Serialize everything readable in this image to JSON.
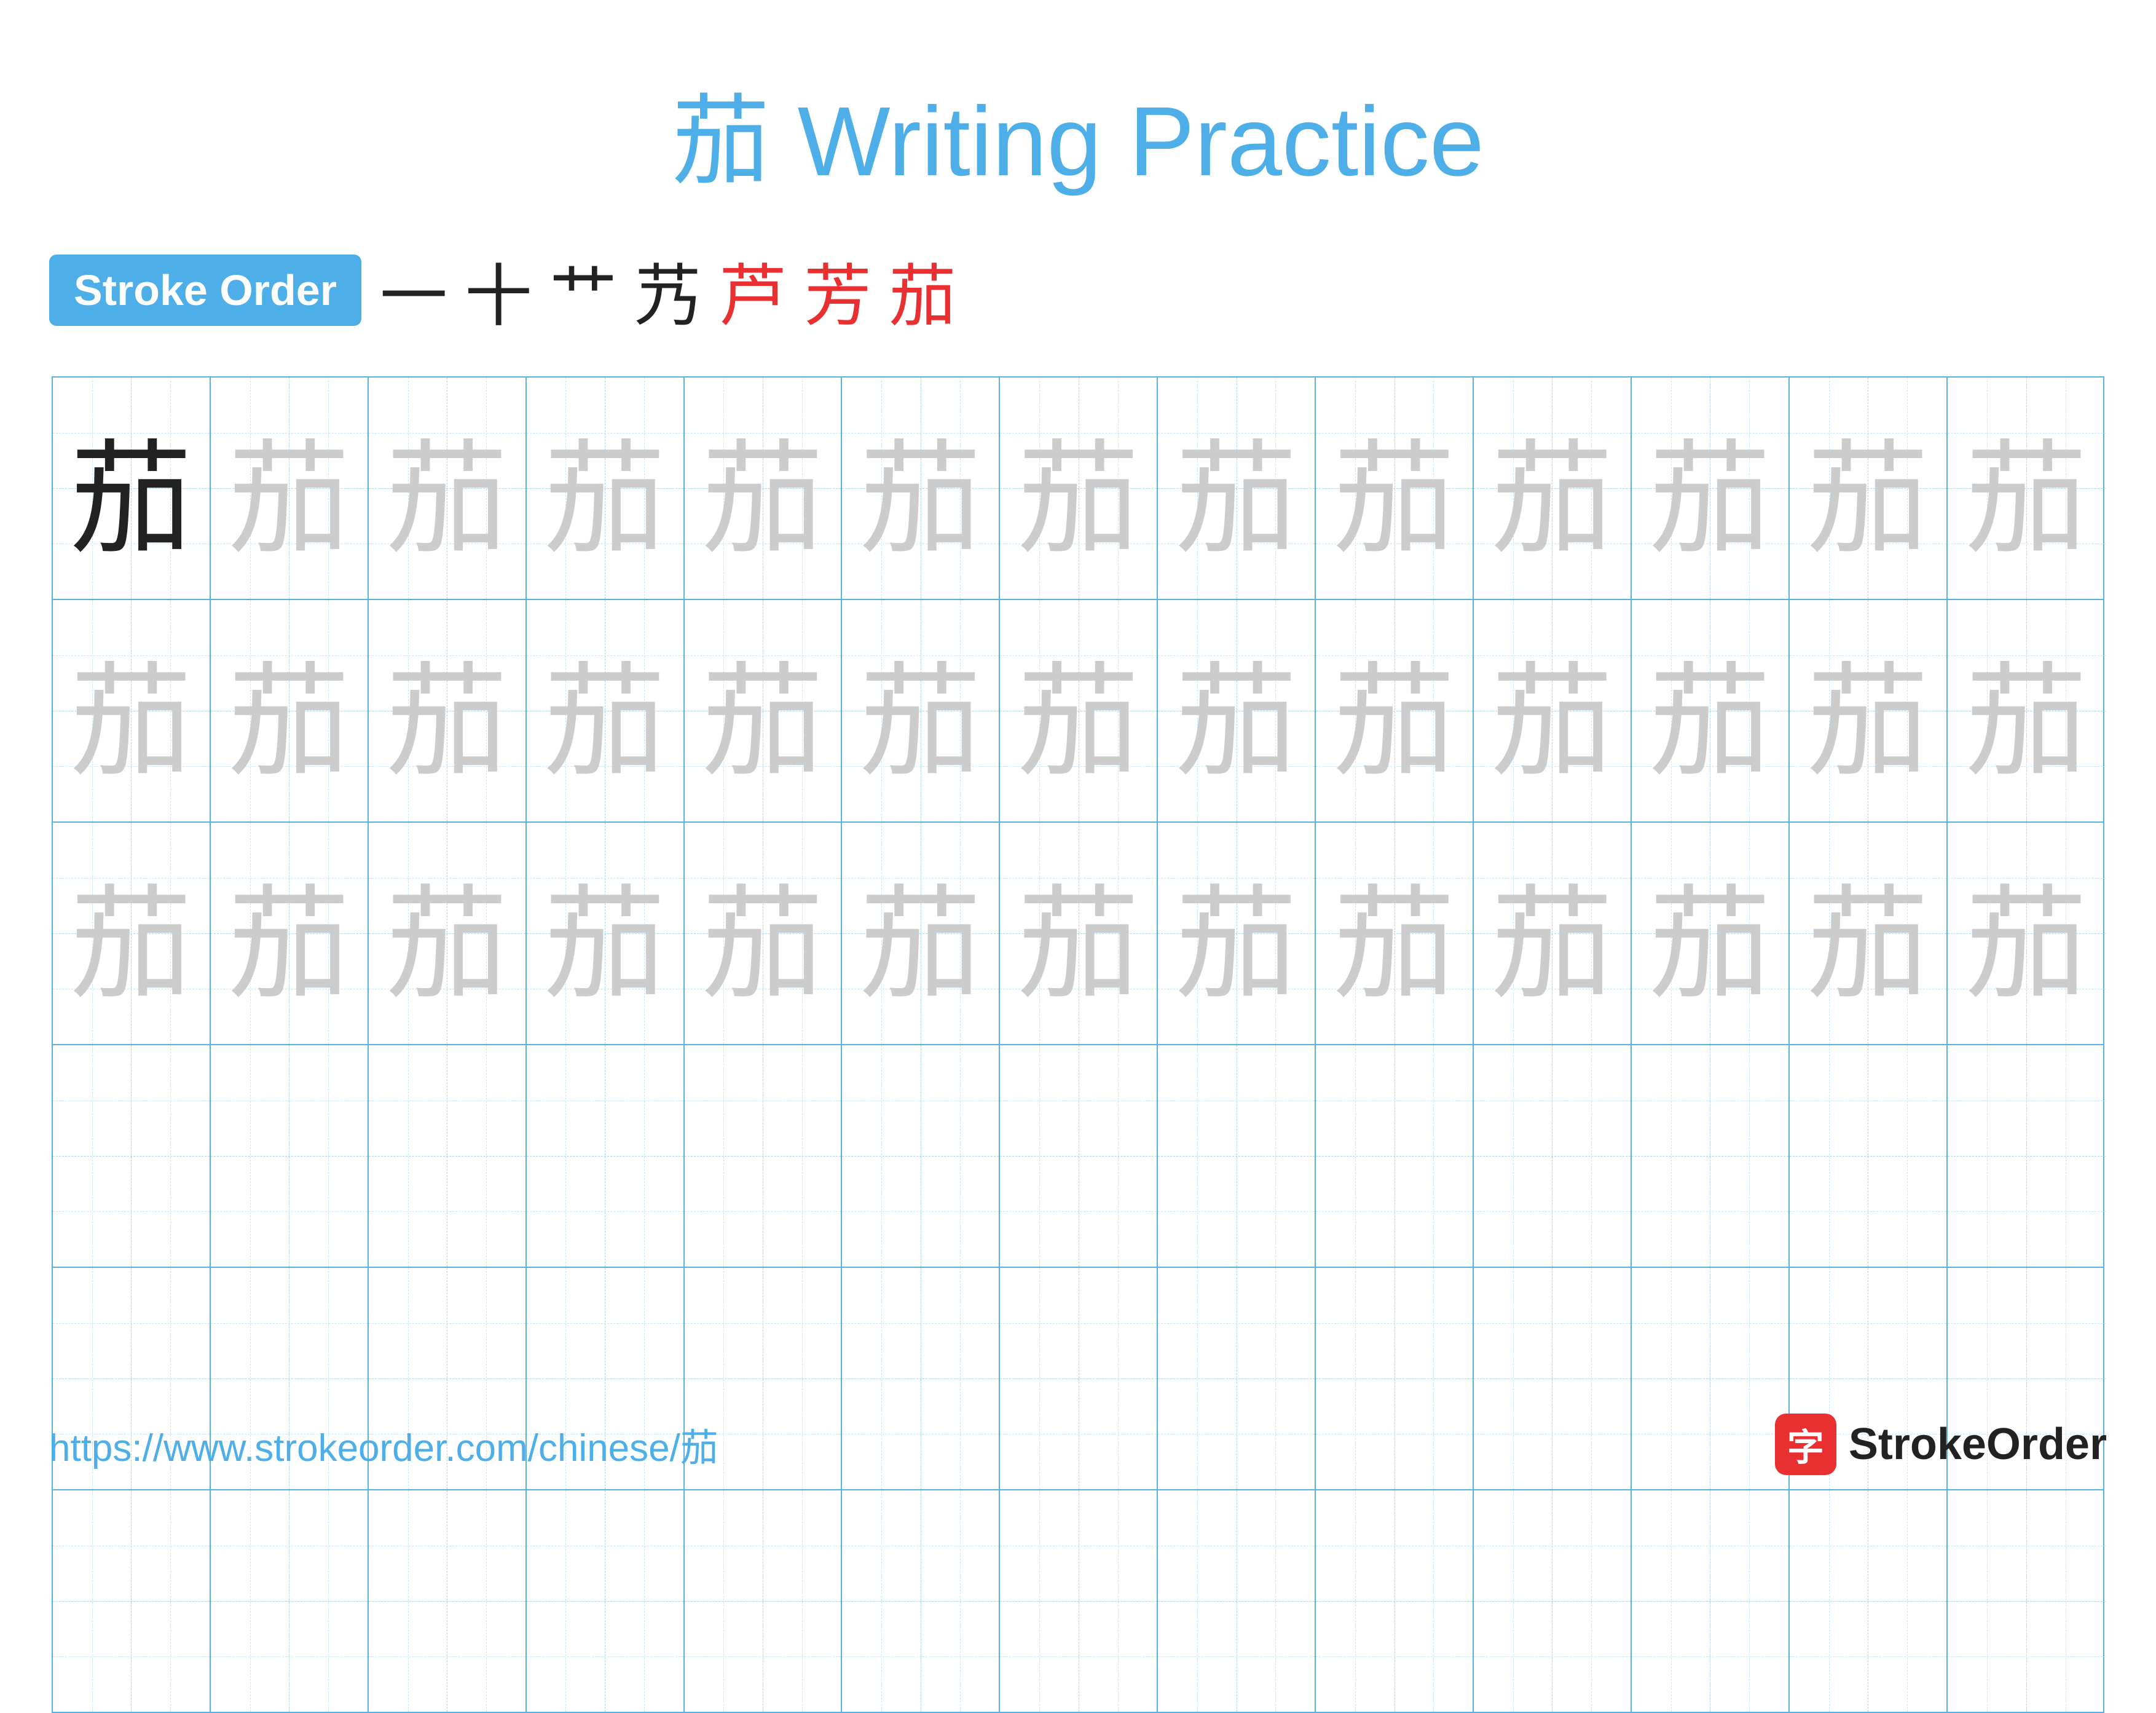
{
  "title": "茄 Writing Practice",
  "stroke_order": {
    "label": "Stroke Order",
    "strokes": [
      {
        "char": "一",
        "color": "dark"
      },
      {
        "char": "十",
        "color": "dark"
      },
      {
        "char": "艹",
        "color": "dark"
      },
      {
        "char": "艿",
        "color": "dark"
      },
      {
        "char": "芦",
        "color": "red"
      },
      {
        "char": "芳",
        "color": "red"
      },
      {
        "char": "茄",
        "color": "red"
      }
    ]
  },
  "character": "茄",
  "rows": [
    {
      "type": "dark_then_light",
      "dark_count": 1,
      "light_count": 12
    },
    {
      "type": "all_light",
      "count": 13
    },
    {
      "type": "all_light",
      "count": 13
    },
    {
      "type": "empty",
      "count": 13
    },
    {
      "type": "empty",
      "count": 13
    },
    {
      "type": "empty",
      "count": 13
    }
  ],
  "footer": {
    "url": "https://www.strokeorder.com/chinese/茄",
    "logo_char": "字",
    "logo_name": "StrokeOrder"
  },
  "colors": {
    "blue": "#4daee8",
    "red": "#e83030",
    "dark": "#222222",
    "light": "#cccccc",
    "grid_border": "#5ab0e0",
    "grid_dash": "#a8d4f0"
  }
}
